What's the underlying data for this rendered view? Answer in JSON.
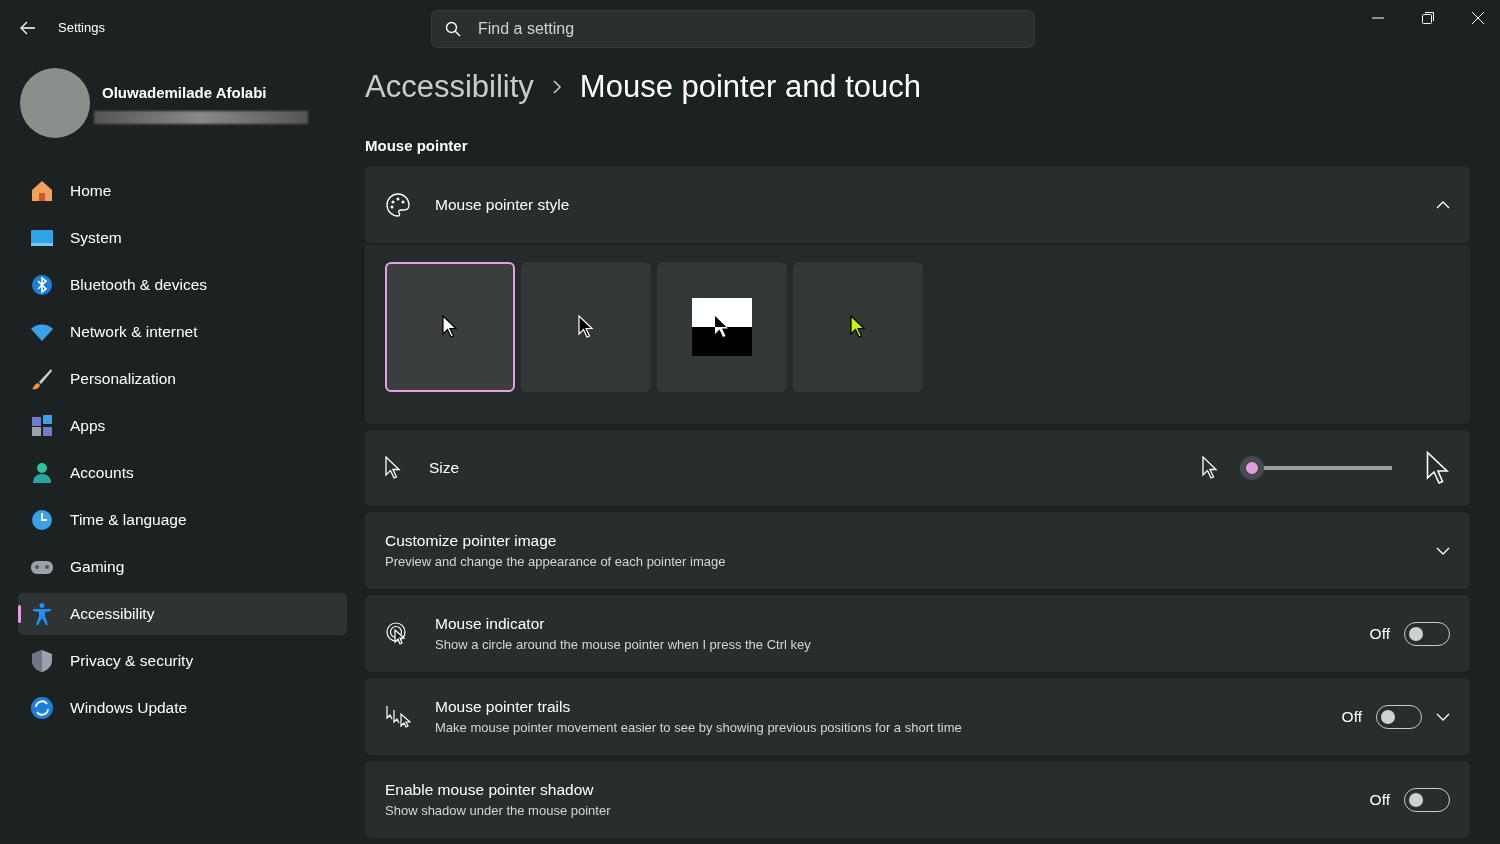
{
  "window": {
    "title": "Settings"
  },
  "search": {
    "placeholder": "Find a setting"
  },
  "user": {
    "name": "Oluwademilade Afolabi"
  },
  "sidebar": {
    "items": [
      {
        "label": "Home",
        "selected": false
      },
      {
        "label": "System",
        "selected": false
      },
      {
        "label": "Bluetooth & devices",
        "selected": false
      },
      {
        "label": "Network & internet",
        "selected": false
      },
      {
        "label": "Personalization",
        "selected": false
      },
      {
        "label": "Apps",
        "selected": false
      },
      {
        "label": "Accounts",
        "selected": false
      },
      {
        "label": "Time & language",
        "selected": false
      },
      {
        "label": "Gaming",
        "selected": false
      },
      {
        "label": "Accessibility",
        "selected": true
      },
      {
        "label": "Privacy & security",
        "selected": false
      },
      {
        "label": "Windows Update",
        "selected": false
      }
    ]
  },
  "breadcrumb": [
    "Accessibility",
    "Mouse pointer and touch"
  ],
  "section_title": "Mouse pointer",
  "pointer_style": {
    "title": "Mouse pointer style",
    "expanded": true,
    "options": [
      {
        "kind": "white",
        "selected": true
      },
      {
        "kind": "black",
        "selected": false
      },
      {
        "kind": "inverted",
        "selected": false
      },
      {
        "kind": "custom",
        "selected": false
      }
    ]
  },
  "size": {
    "label": "Size",
    "level": 0
  },
  "settings": [
    {
      "kind": "expander",
      "title": "Customize pointer image",
      "description": "Preview and change the appearance of each pointer image"
    },
    {
      "kind": "toggle",
      "icon": true,
      "title": "Mouse indicator",
      "description": "Show a circle around the mouse pointer when I press the Ctrl key",
      "state_text": "Off",
      "on": false
    },
    {
      "kind": "toggle-expander",
      "icon": true,
      "title": "Mouse pointer trails",
      "description": "Make mouse pointer movement easier to see by showing previous positions for a short time",
      "state_text": "Off",
      "on": false
    },
    {
      "kind": "toggle",
      "icon": false,
      "title": "Enable mouse pointer shadow",
      "description": "Show shadow under the mouse pointer",
      "state_text": "Off",
      "on": false
    }
  ]
}
